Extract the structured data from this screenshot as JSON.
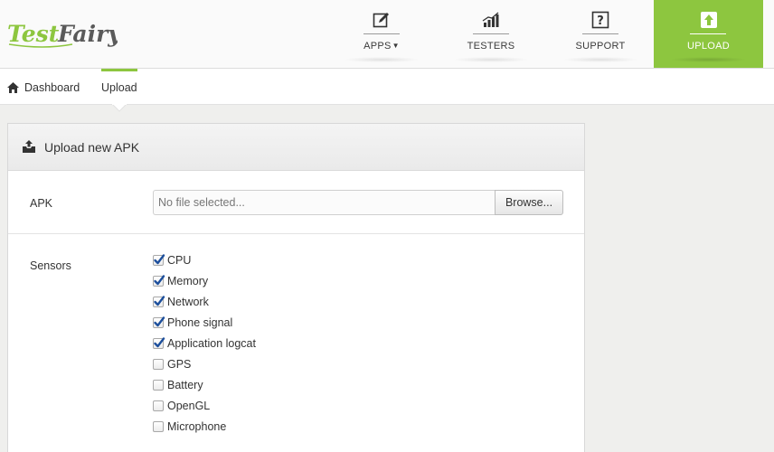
{
  "brand": {
    "name_part1": "Test",
    "name_part2": "Fairy",
    "accent_color": "#8dc63f"
  },
  "nav": {
    "items": [
      {
        "label": "APPS",
        "icon": "edit-icon",
        "has_dropdown": true
      },
      {
        "label": "TESTERS",
        "icon": "bar-chart-icon"
      },
      {
        "label": "SUPPORT",
        "icon": "question-icon"
      },
      {
        "label": "UPLOAD",
        "icon": "upload-icon",
        "active": true
      }
    ],
    "dropdown_caret": "▼"
  },
  "breadcrumb": {
    "home_icon": "home-icon",
    "items": [
      "Dashboard",
      "Upload"
    ],
    "active_index": 1
  },
  "panel": {
    "icon": "inbox-upload-icon",
    "title": "Upload new APK",
    "apk": {
      "label": "APK",
      "placeholder": "No file selected...",
      "browse_label": "Browse..."
    },
    "sensors": {
      "label": "Sensors",
      "items": [
        {
          "label": "CPU",
          "checked": true
        },
        {
          "label": "Memory",
          "checked": true
        },
        {
          "label": "Network",
          "checked": true
        },
        {
          "label": "Phone signal",
          "checked": true
        },
        {
          "label": "Application logcat",
          "checked": true
        },
        {
          "label": "GPS",
          "checked": false
        },
        {
          "label": "Battery",
          "checked": false
        },
        {
          "label": "OpenGL",
          "checked": false
        },
        {
          "label": "Microphone",
          "checked": false
        }
      ]
    }
  }
}
